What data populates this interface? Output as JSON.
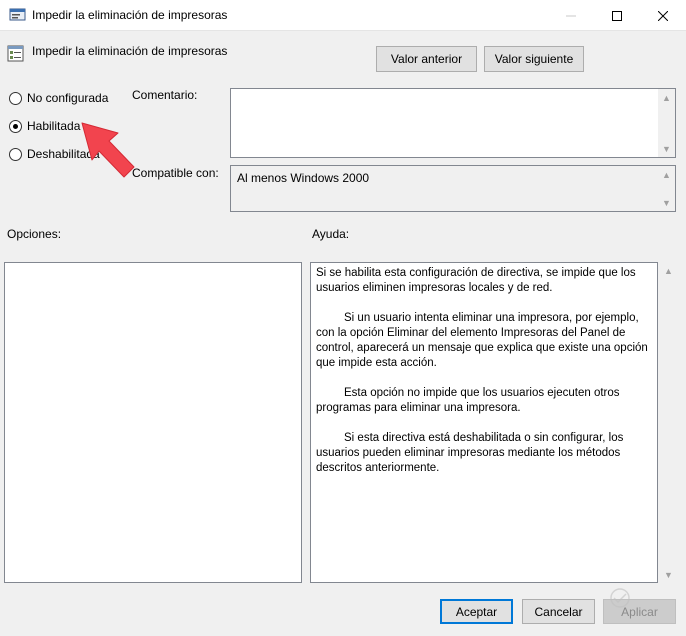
{
  "window": {
    "title": "Impedir la eliminación de impresoras",
    "icon": "policy-settings-icon"
  },
  "header": {
    "title": "Impedir la eliminación de impresoras",
    "prev_label": "Valor anterior",
    "next_label": "Valor siguiente"
  },
  "radios": [
    {
      "label": "No configurada",
      "checked": false
    },
    {
      "label": "Habilitada",
      "checked": true
    },
    {
      "label": "Deshabilitada",
      "checked": false
    }
  ],
  "comment": {
    "label": "Comentario:",
    "value": ""
  },
  "compat": {
    "label": "Compatible con:",
    "value": "Al menos Windows 2000"
  },
  "options": {
    "label": "Opciones:"
  },
  "help": {
    "label": "Ayuda:",
    "paragraphs": [
      "Si se habilita esta configuración de directiva, se impide que los usuarios eliminen impresoras locales y de red.",
      "Si un usuario intenta eliminar una impresora, por ejemplo, con la opción Eliminar del elemento Impresoras del Panel de control, aparecerá un mensaje que explica que existe una opción que impide esta acción.",
      "Esta opción no impide que los usuarios ejecuten otros programas para eliminar una impresora.",
      "Si esta directiva está deshabilitada o sin configurar, los usuarios pueden eliminar impresoras mediante los métodos descritos anteriormente."
    ]
  },
  "footer": {
    "ok_label": "Aceptar",
    "cancel_label": "Cancelar",
    "apply_label": "Aplicar"
  },
  "colors": {
    "accent": "#0078d7",
    "annotation_arrow": "#f2444e"
  }
}
